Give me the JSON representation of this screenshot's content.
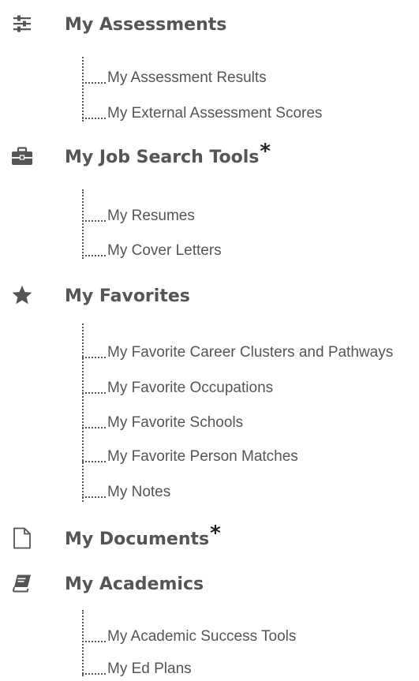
{
  "sections": [
    {
      "title": "My Assessments",
      "icon": "sliders-icon",
      "asterisk": "",
      "items": [
        "My Assessment Results",
        "My External Assessment Scores"
      ]
    },
    {
      "title": "My Job Search Tools",
      "icon": "briefcase-icon",
      "asterisk": "*",
      "items": [
        "My Resumes",
        "My Cover Letters"
      ]
    },
    {
      "title": "My Favorites",
      "icon": "star-icon",
      "asterisk": "",
      "items": [
        "My Favorite Career Clusters and Pathways",
        "My Favorite Occupations",
        "My Favorite Schools",
        "My Favorite Person Matches",
        "My Notes"
      ]
    },
    {
      "title": "My Documents",
      "icon": "document-icon",
      "asterisk": "*",
      "items": []
    },
    {
      "title": "My Academics",
      "icon": "book-icon",
      "asterisk": "",
      "items": [
        "My Academic Success Tools",
        "My Ed Plans"
      ]
    }
  ],
  "colors": {
    "text": "#555555",
    "asterisk": "#222222",
    "icon": "#555555"
  }
}
